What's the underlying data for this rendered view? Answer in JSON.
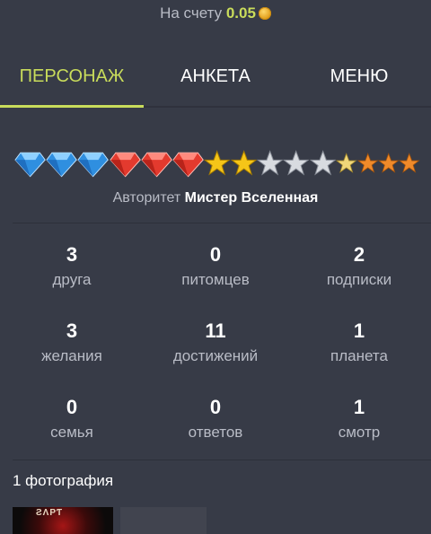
{
  "balance": {
    "label": "На счету",
    "amount": "0.05",
    "icon": "coin-icon"
  },
  "tabs": [
    {
      "label": "ПЕРСОНАЖ",
      "active": true
    },
    {
      "label": "АНКЕТА",
      "active": false
    },
    {
      "label": "МЕНЮ",
      "active": false
    }
  ],
  "authority": {
    "badges": {
      "blue_diamonds": 3,
      "red_diamonds": 3,
      "gold_stars": 2,
      "silver_stars": 3,
      "small_gold_stars": 1,
      "small_orange_stars": 3
    },
    "label": "Авторитет",
    "rank": "Мистер Вселенная"
  },
  "stats": [
    {
      "value": "3",
      "label": "друга"
    },
    {
      "value": "0",
      "label": "питомцев"
    },
    {
      "value": "2",
      "label": "подписки"
    },
    {
      "value": "3",
      "label": "желания"
    },
    {
      "value": "11",
      "label": "достижений"
    },
    {
      "value": "1",
      "label": "планета"
    },
    {
      "value": "0",
      "label": "семья"
    },
    {
      "value": "0",
      "label": "ответов"
    },
    {
      "value": "1",
      "label": "смотр"
    }
  ],
  "photos": {
    "title": "1 фотография"
  },
  "colors": {
    "background": "#373b47",
    "accent": "#c9dc5b",
    "muted_text": "#b9bcc6"
  }
}
